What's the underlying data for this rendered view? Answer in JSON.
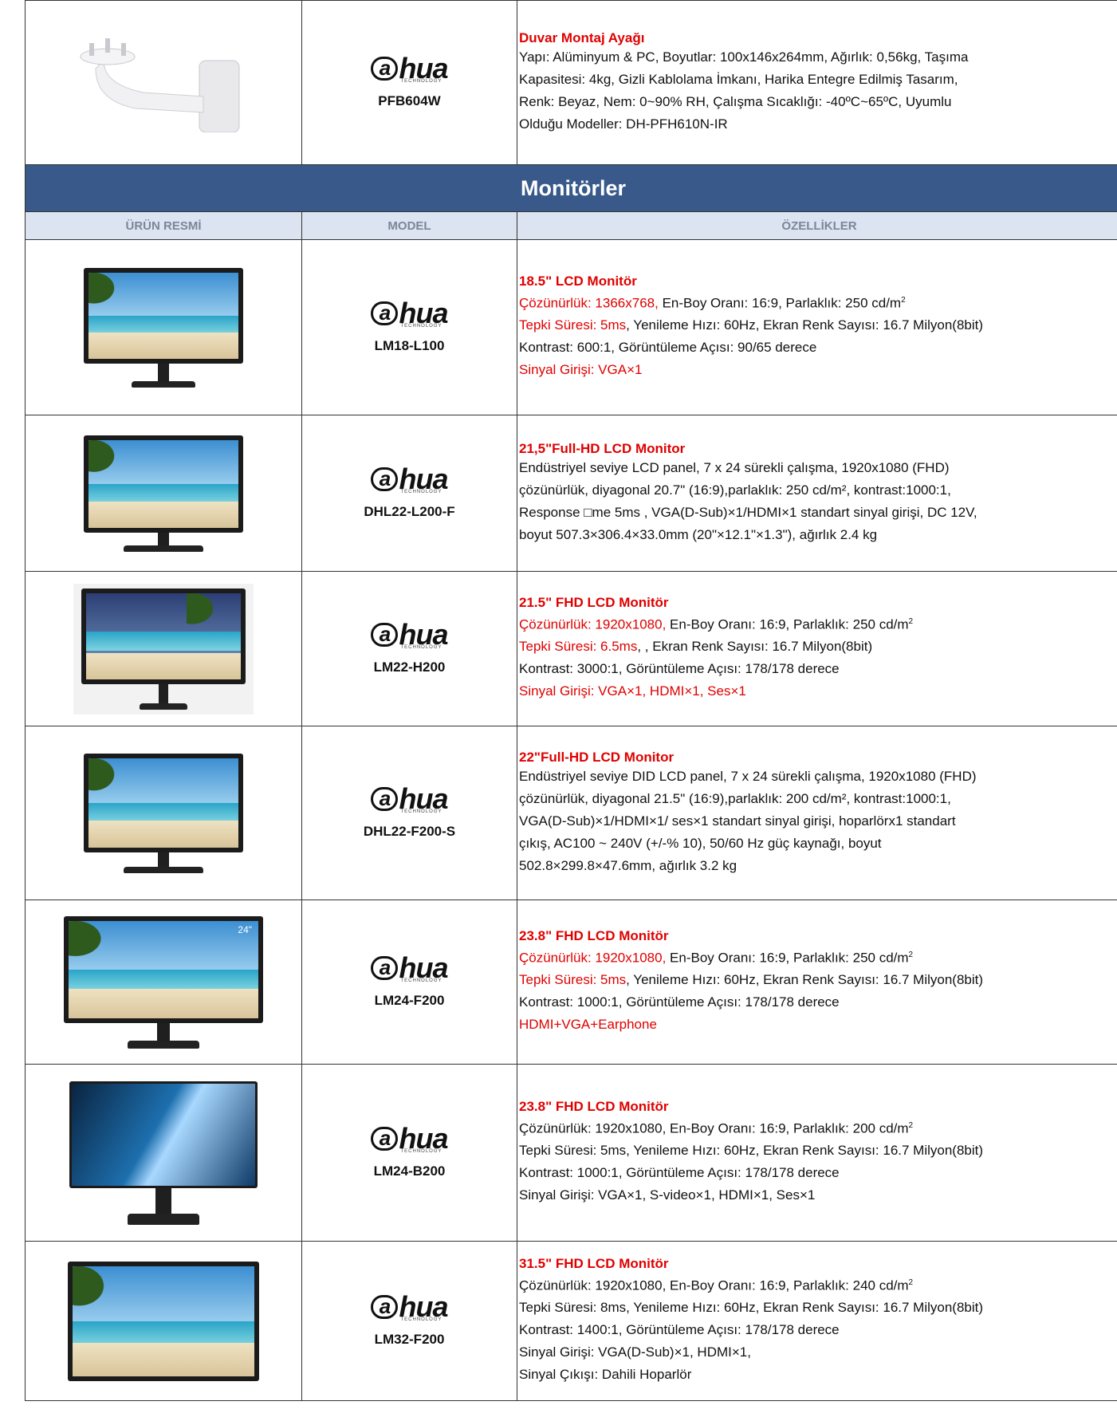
{
  "brand": {
    "name": "hua",
    "letter": "a",
    "tagline": "TECHNOLOGY"
  },
  "top_row": {
    "model": "PFB604W",
    "title": "Duvar Montaj Ayağı",
    "lines": [
      "Yapı: Alüminyum & PC, Boyutlar: 100x146x264mm, Ağırlık: 0,56kg, Taşıma",
      "Kapasitesi: 4kg, Gizli Kablolama İmkanı, Harika Entegre Edilmiş Tasarım,",
      "Renk: Beyaz, Nem: 0~90% RH, Çalışma Sıcaklığı: -40ºC~65ºC, Uyumlu",
      "Olduğu Modeller: DH-PFH610N-IR"
    ]
  },
  "section": {
    "title": "Monitörler"
  },
  "headers": {
    "image": "ÜRÜN RESMİ",
    "model": "MODEL",
    "specs": "ÖZELLİKLER"
  },
  "products": [
    {
      "model": "LM18-L100",
      "title": "18.5\" LCD Monitör",
      "l1_red": "Çözünürlük: 1366x768,",
      "l1_rest": " En-Boy Oranı: 16:9, Parlaklık: 250 cd/m",
      "l2_red": "Tepki Süresi: 5ms",
      "l2_rest": ", Yenileme Hızı: 60Hz, Ekran Renk Sayısı: 16.7 Milyon(8bit)",
      "l3": "Kontrast: 600:1, Görüntüleme Açısı: 90/65 derece",
      "l4_red": "Sinyal Girişi: VGA×1"
    },
    {
      "model": "DHL22-L200-F",
      "title": "21,5\"Full-HD LCD Monitor",
      "lines": [
        "Endüstriyel seviye LCD panel, 7 x 24 sürekli çalışma, 1920x1080 (FHD)",
        "çözünürlük, diyagonal 20.7\" (16:9),parlaklık: 250 cd/m², kontrast:1000:1,",
        "Response □me 5ms , VGA(D-Sub)×1/HDMI×1 standart sinyal girişi, DC 12V,",
        "boyut 507.3×306.4×33.0mm (20\"×12.1\"×1.3\"), ağırlık 2.4 kg"
      ]
    },
    {
      "model": "LM22-H200",
      "title": "21.5\" FHD LCD Monitör",
      "l1_red": "Çözünürlük: 1920x1080,",
      "l1_rest": " En-Boy Oranı: 16:9, Parlaklık: 250 cd/m",
      "l2_red": "Tepki Süresi: 6.5ms",
      "l2_rest": ", , Ekran Renk Sayısı: 16.7 Milyon(8bit)",
      "l3": "Kontrast: 3000:1, Görüntüleme Açısı: 178/178 derece",
      "l4_red": "Sinyal Girişi: VGA×1, HDMI×1, Ses×1"
    },
    {
      "model": "DHL22-F200-S",
      "title": "22\"Full-HD LCD Monitor",
      "lines": [
        "Endüstriyel seviye DID LCD panel, 7 x 24 sürekli çalışma, 1920x1080 (FHD)",
        "çözünürlük, diyagonal 21.5\" (16:9),parlaklık: 200 cd/m², kontrast:1000:1,",
        "VGA(D-Sub)×1/HDMI×1/ ses×1 standart sinyal girişi,  hoparlörx1 standart",
        "çıkış, AC100 ~ 240V (+/-% 10), 50/60 Hz güç kaynağı,  boyut",
        "502.8×299.8×47.6mm, ağırlık 3.2 kg"
      ]
    },
    {
      "model": "LM24-F200",
      "title": "23.8\" FHD LCD Monitör",
      "badge": "24\"",
      "l1_red": "Çözünürlük: 1920x1080,",
      "l1_rest": " En-Boy Oranı: 16:9, Parlaklık: 250 cd/m",
      "l2_red": "Tepki Süresi: 5ms",
      "l2_rest": ", Yenileme Hızı: 60Hz, Ekran Renk Sayısı: 16.7 Milyon(8bit)",
      "l3": "Kontrast: 1000:1, Görüntüleme Açısı: 178/178 derece",
      "l4_red": "HDMI+VGA+Earphone"
    },
    {
      "model": "LM24-B200",
      "title": "23.8\" FHD LCD Monitör",
      "lines": [
        "Çözünürlük: 1920x1080, En-Boy Oranı: 16:9, Parlaklık: 200 cd/m",
        "Tepki Süresi: 5ms, Yenileme Hızı: 60Hz, Ekran Renk Sayısı: 16.7 Milyon(8bit)",
        "Kontrast: 1000:1, Görüntüleme Açısı: 178/178 derece",
        "Sinyal Girişi:  VGA×1, S-video×1, HDMI×1, Ses×1"
      ]
    },
    {
      "model": "LM32-F200",
      "title": "31.5\" FHD LCD Monitör",
      "lines": [
        "Çözünürlük: 1920x1080, En-Boy Oranı: 16:9, Parlaklık: 240 cd/m",
        "Tepki Süresi: 8ms, Yenileme Hızı: 60Hz, Ekran Renk Sayısı: 16.7 Milyon(8bit)",
        "Kontrast: 1400:1, Görüntüleme Açısı: 178/178 derece",
        "Sinyal Girişi: VGA(D-Sub)×1, HDMI×1,",
        "Sinyal Çıkışı: Dahili Hoparlör"
      ]
    }
  ],
  "sup2": "2",
  "colors": {
    "section_bg": "#38598a",
    "header_bg": "#dbe4f0",
    "header_text": "#7b8699",
    "accent_red": "#e00000"
  }
}
